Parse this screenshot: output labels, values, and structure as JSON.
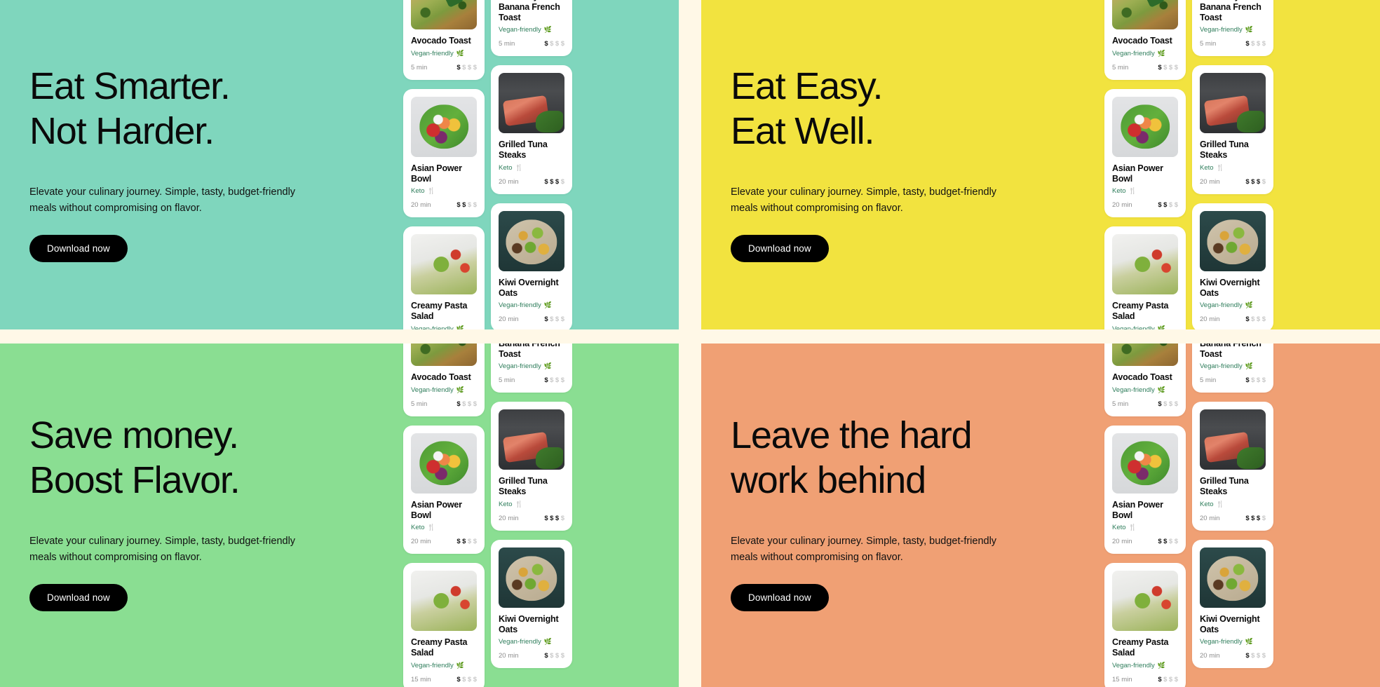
{
  "page": {
    "background": "#FFF8E7"
  },
  "shared": {
    "body_copy": "Elevate your culinary journey. Simple, tasty, budget-friendly meals without compromising on flavor.",
    "cta_label": "Download now"
  },
  "panels": [
    {
      "id": "panel-a",
      "background": "#7FD6BD",
      "headline": "Eat Smarter.\nNot Harder.",
      "body": "Elevate your culinary journey. Simple, tasty, budget-friendly meals without compromising on flavor.",
      "cta": "Download now"
    },
    {
      "id": "panel-b",
      "background": "#F2E33F",
      "headline": "Eat Easy.\nEat Well.",
      "body": "Elevate your culinary journey. Simple, tasty, budget-friendly meals without compromising on flavor.",
      "cta": "Download now"
    },
    {
      "id": "panel-c",
      "background": "#8ADE92",
      "headline": "Save money.\nBoost Flavor.",
      "body": "Elevate your culinary journey. Simple, tasty, budget-friendly meals without compromising on flavor.",
      "cta": "Download now"
    },
    {
      "id": "panel-d",
      "background": "#F0A074",
      "headline": "Leave the hard\nwork behind",
      "body": "Elevate your culinary journey. Simple, tasty, budget-friendly meals without compromising on flavor.",
      "cta": "Download now"
    }
  ],
  "cards": {
    "column_one": [
      {
        "title": "Avocado Toast",
        "tag": "Vegan-friendly",
        "tag_icon": "leaf-icon",
        "time": "5 min",
        "price_filled": 1,
        "price_total": 4,
        "image": "avocado-toast-photo"
      },
      {
        "title": "Asian Power Bowl",
        "tag": "Keto",
        "tag_icon": "cutlery-icon",
        "time": "20 min",
        "price_filled": 2,
        "price_total": 4,
        "image": "asian-power-bowl-photo"
      },
      {
        "title": "Creamy Pasta Salad",
        "tag": "Vegan-friendly",
        "tag_icon": "leaf-icon",
        "time": "15 min",
        "price_filled": 1,
        "price_total": 4,
        "image": "pasta-salad-photo"
      }
    ],
    "column_two": [
      {
        "title": "Blueberry & Banana French Toast",
        "tag": "Vegan-friendly",
        "tag_icon": "leaf-icon",
        "time": "5 min",
        "price_filled": 1,
        "price_total": 4,
        "image": "french-toast-photo"
      },
      {
        "title": "Grilled Tuna Steaks",
        "tag": "Keto",
        "tag_icon": "cutlery-icon",
        "time": "20 min",
        "price_filled": 3,
        "price_total": 4,
        "image": "grilled-tuna-photo"
      },
      {
        "title": "Kiwi Overnight Oats",
        "tag": "Vegan-friendly",
        "tag_icon": "leaf-icon",
        "time": "20 min",
        "price_filled": 1,
        "price_total": 4,
        "image": "kiwi-oats-photo"
      }
    ]
  },
  "icons": {
    "leaf": "❦",
    "cutlery": "🍴",
    "currency": "$"
  }
}
